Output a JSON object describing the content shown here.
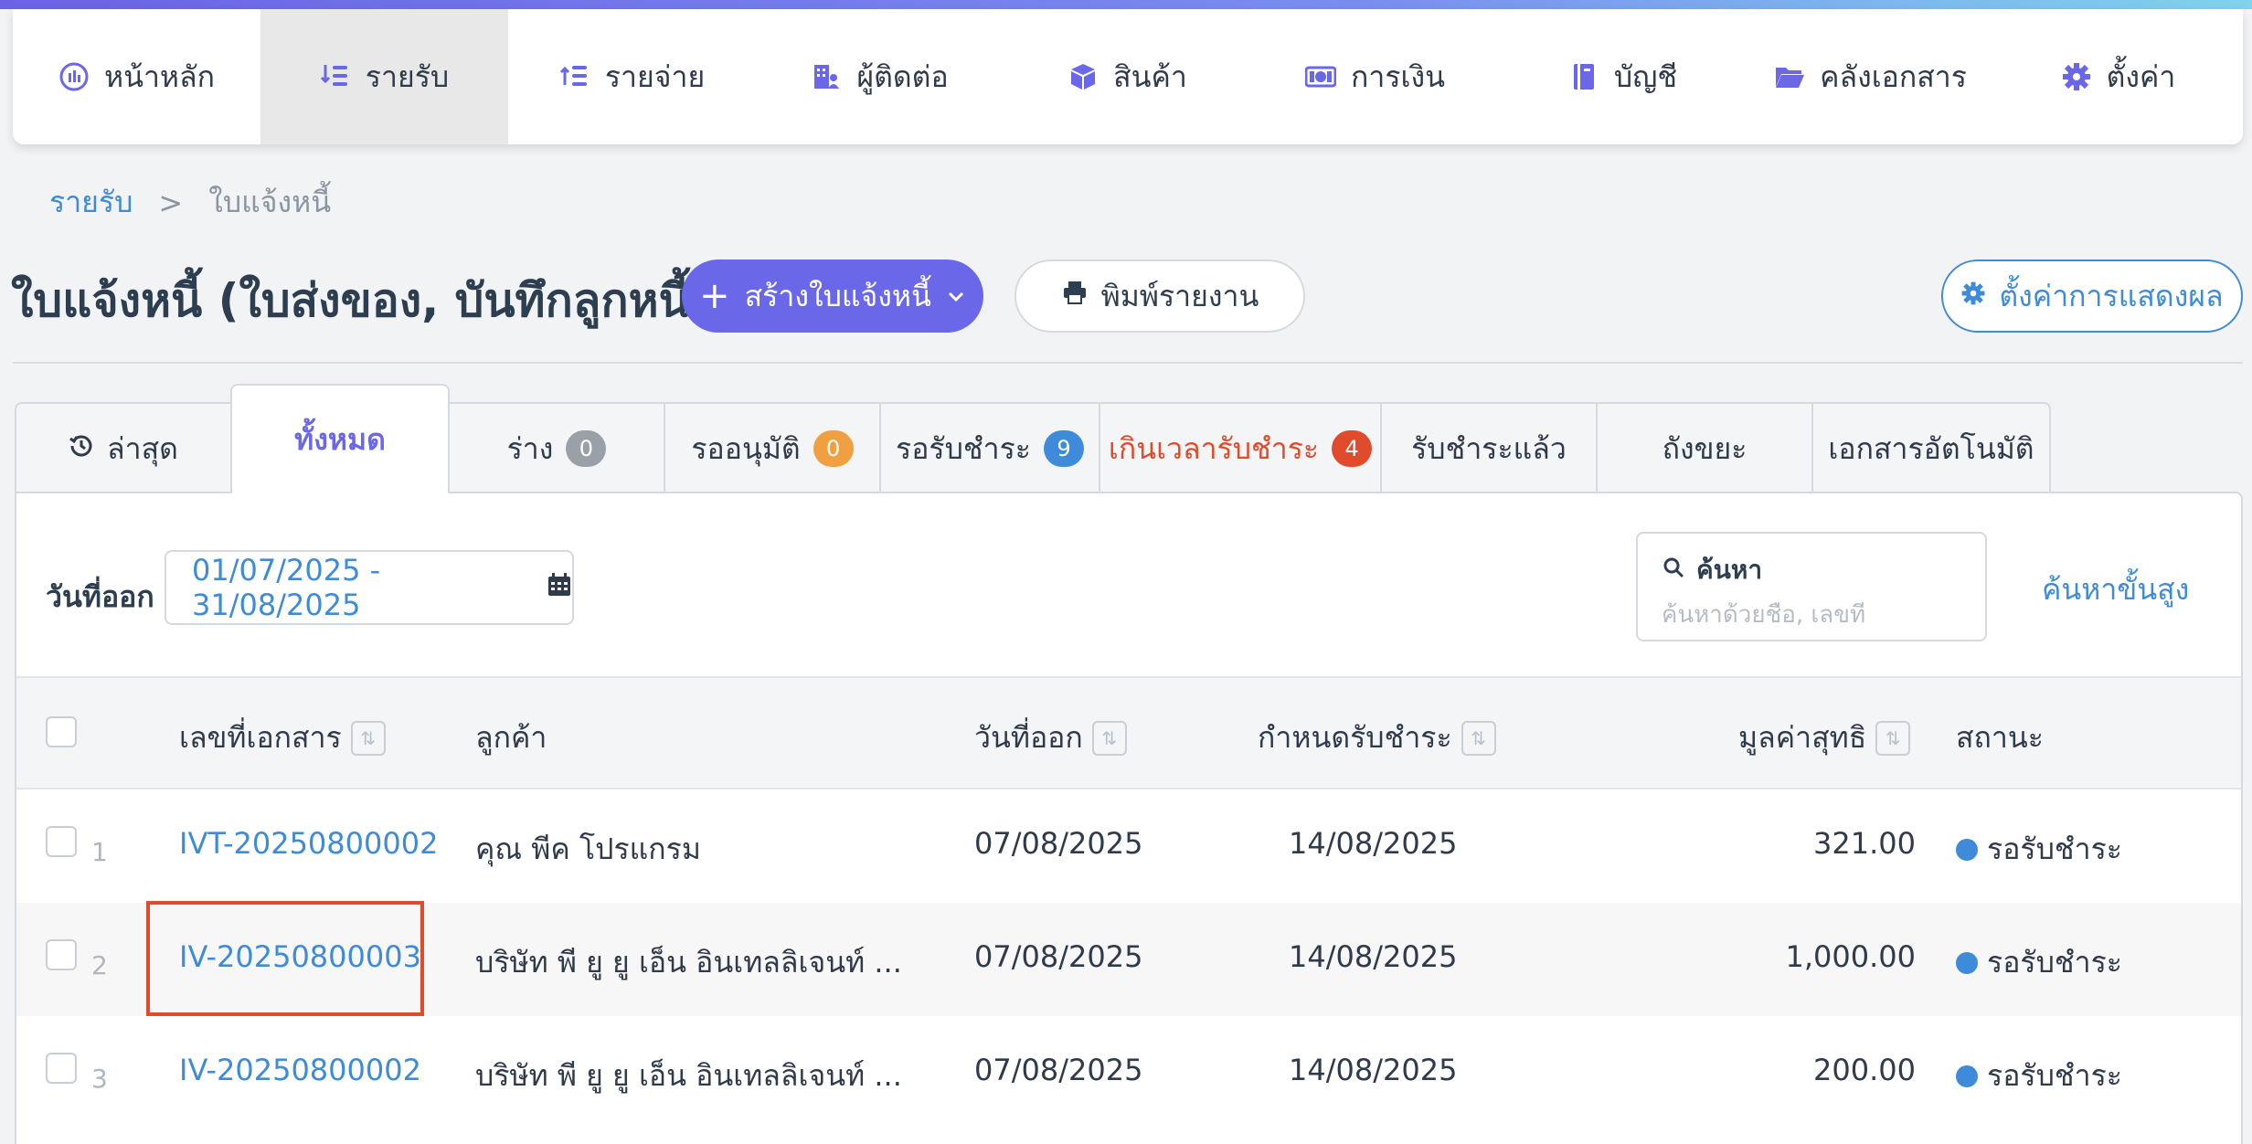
{
  "nav": [
    {
      "label": "หน้าหลัก",
      "icon": "dashboard-icon",
      "active": false
    },
    {
      "label": "รายรับ",
      "icon": "income-icon",
      "active": true
    },
    {
      "label": "รายจ่าย",
      "icon": "expense-icon",
      "active": false
    },
    {
      "label": "ผู้ติดต่อ",
      "icon": "contacts-icon",
      "active": false
    },
    {
      "label": "สินค้า",
      "icon": "box-icon",
      "active": false
    },
    {
      "label": "การเงิน",
      "icon": "money-icon",
      "active": false
    },
    {
      "label": "บัญชี",
      "icon": "ledger-icon",
      "active": false
    },
    {
      "label": "คลังเอกสาร",
      "icon": "folder-icon",
      "active": false
    },
    {
      "label": "ตั้งค่า",
      "icon": "gear-icon",
      "active": false
    }
  ],
  "breadcrumb": {
    "parent": "รายรับ",
    "separator": ">",
    "current": "ใบแจ้งหนี้"
  },
  "page": {
    "title": "ใบแจ้งหนี้ (ใบส่งของ, บันทึกลูกหนี้)",
    "create_button": "สร้างใบแจ้งหนี้",
    "print_button": "พิมพ์รายงาน",
    "display_settings_button": "ตั้งค่าการแสดงผล"
  },
  "tabs": [
    {
      "label": "ล่าสุด",
      "icon": "history-icon"
    },
    {
      "label": "ทั้งหมด",
      "active": true
    },
    {
      "label": "ร่าง",
      "count": "0",
      "badge_color": "#9aa0a8"
    },
    {
      "label": "รออนุมัติ",
      "count": "0",
      "badge_color": "#f0a040"
    },
    {
      "label": "รอรับชำระ",
      "count": "9",
      "badge_color": "#3d8bd9"
    },
    {
      "label": "เกินเวลารับชำระ",
      "count": "4",
      "badge_color": "#e04b2c"
    },
    {
      "label": "รับชำระแล้ว"
    },
    {
      "label": "ถังขยะ"
    },
    {
      "label": "เอกสารอัตโนมัติ"
    }
  ],
  "filters": {
    "date_label": "วันที่ออก",
    "date_range": "01/07/2025 - 31/08/2025",
    "search_label": "ค้นหา",
    "search_placeholder": "ค้นหาด้วยชื่อ, เลขที่",
    "advanced_search": "ค้นหาขั้นสูง"
  },
  "table": {
    "columns": {
      "doc_no": "เลขที่เอกสาร",
      "customer": "ลูกค้า",
      "issue_date": "วันที่ออก",
      "due_date": "กำหนดรับชำระ",
      "net_amount": "มูลค่าสุทธิ",
      "status": "สถานะ"
    },
    "rows": [
      {
        "num": "1",
        "doc_no": "IVT-20250800002",
        "customer": "คุณ พีค โปรแกรม",
        "issue_date": "07/08/2025",
        "due_date": "14/08/2025",
        "net_amount": "321.00",
        "status": "รอรับชำระ"
      },
      {
        "num": "2",
        "doc_no": "IV-20250800003",
        "customer": "บริษัท พี ยู ยู เอ็น อินเทลลิเจนท์ ...",
        "issue_date": "07/08/2025",
        "due_date": "14/08/2025",
        "net_amount": "1,000.00",
        "status": "รอรับชำระ"
      },
      {
        "num": "3",
        "doc_no": "IV-20250800002",
        "customer": "บริษัท พี ยู ยู เอ็น อินเทลลิเจนท์ ...",
        "issue_date": "07/08/2025",
        "due_date": "14/08/2025",
        "net_amount": "200.00",
        "status": "รอรับชำระ"
      }
    ]
  },
  "colors": {
    "accent": "#6a67e9",
    "link": "#3d8bd9",
    "danger": "#e04b2c",
    "highlight": "#e04b2c"
  }
}
